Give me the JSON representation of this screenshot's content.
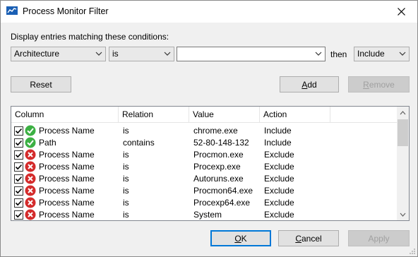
{
  "window": {
    "title": "Process Monitor Filter"
  },
  "conditions_label": "Display entries matching these conditions:",
  "column_select": "Architecture",
  "relation_select": "is",
  "value_input": "",
  "then_label": "then",
  "action_select": "Include",
  "buttons": {
    "reset": "Reset",
    "add_prefix": "A",
    "add_rest": "dd",
    "remove_prefix": "R",
    "remove_rest": "emove",
    "ok_prefix": "O",
    "ok_rest": "K",
    "cancel_prefix": "C",
    "cancel_rest": "ancel",
    "apply": "Apply"
  },
  "list": {
    "headers": [
      "Column",
      "Relation",
      "Value",
      "Action"
    ],
    "rows": [
      {
        "checked": true,
        "status": "include",
        "column": "Process Name",
        "relation": "is",
        "value": "chrome.exe",
        "action": "Include"
      },
      {
        "checked": true,
        "status": "include",
        "column": "Path",
        "relation": "contains",
        "value": "52-80-148-132",
        "action": "Include"
      },
      {
        "checked": true,
        "status": "exclude",
        "column": "Process Name",
        "relation": "is",
        "value": "Procmon.exe",
        "action": "Exclude"
      },
      {
        "checked": true,
        "status": "exclude",
        "column": "Process Name",
        "relation": "is",
        "value": "Procexp.exe",
        "action": "Exclude"
      },
      {
        "checked": true,
        "status": "exclude",
        "column": "Process Name",
        "relation": "is",
        "value": "Autoruns.exe",
        "action": "Exclude"
      },
      {
        "checked": true,
        "status": "exclude",
        "column": "Process Name",
        "relation": "is",
        "value": "Procmon64.exe",
        "action": "Exclude"
      },
      {
        "checked": true,
        "status": "exclude",
        "column": "Process Name",
        "relation": "is",
        "value": "Procexp64.exe",
        "action": "Exclude"
      },
      {
        "checked": true,
        "status": "exclude",
        "column": "Process Name",
        "relation": "is",
        "value": "System",
        "action": "Exclude"
      }
    ]
  },
  "colors": {
    "include": "#3cb043",
    "exclude": "#d42b2b",
    "focus": "#0078d7"
  }
}
